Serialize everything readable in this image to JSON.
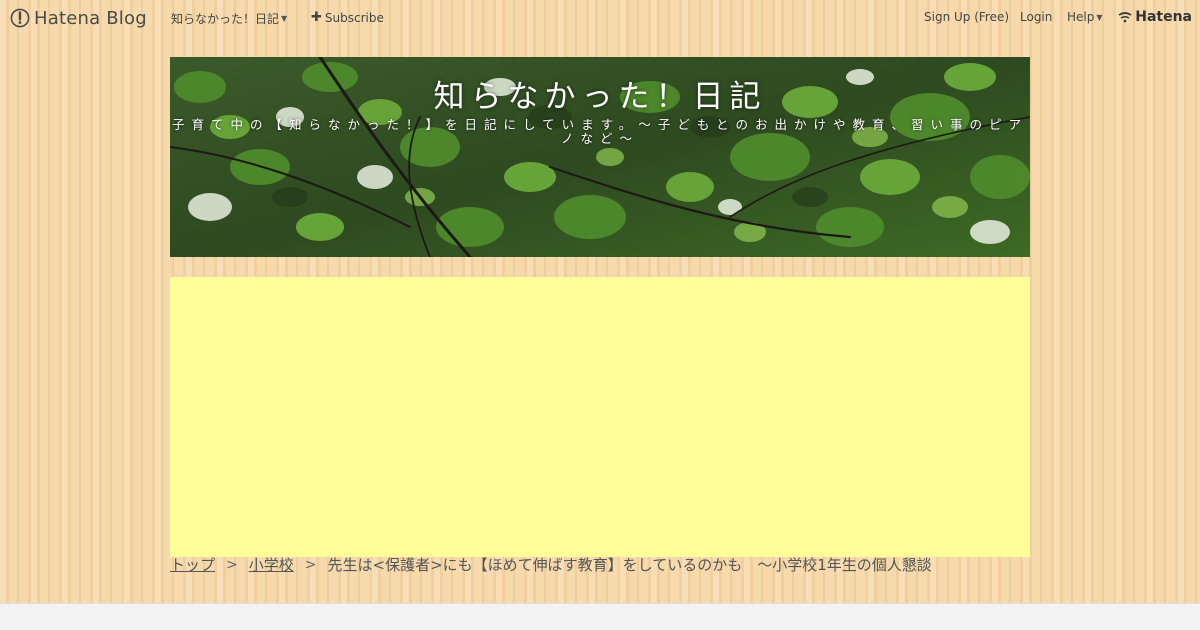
{
  "globalheader": {
    "logo_text": "Hatena Blog",
    "blog_menu_label": "知らなかった！日記",
    "subscribe_label": "Subscribe",
    "signup_label": "Sign Up (Free)",
    "login_label": "Login",
    "help_label": "Help",
    "brand_label": "Hatena"
  },
  "blog": {
    "title": "知らなかった！日記",
    "description": "子育て中の【知らなかった！】を日記にしています。～子どもとのお出かけや教育、習い事のピアノなど～"
  },
  "breadcrumb": {
    "items": [
      "トップ",
      "小学校"
    ],
    "separator": ">",
    "current": "先生は<保護者>にも【ほめて伸ばす教育】をしているのかも　～小学校1年生の個人懇談"
  },
  "colors": {
    "ad_background": "#ffff99",
    "wood_background": "#f5d7a6",
    "text": "#444444"
  }
}
